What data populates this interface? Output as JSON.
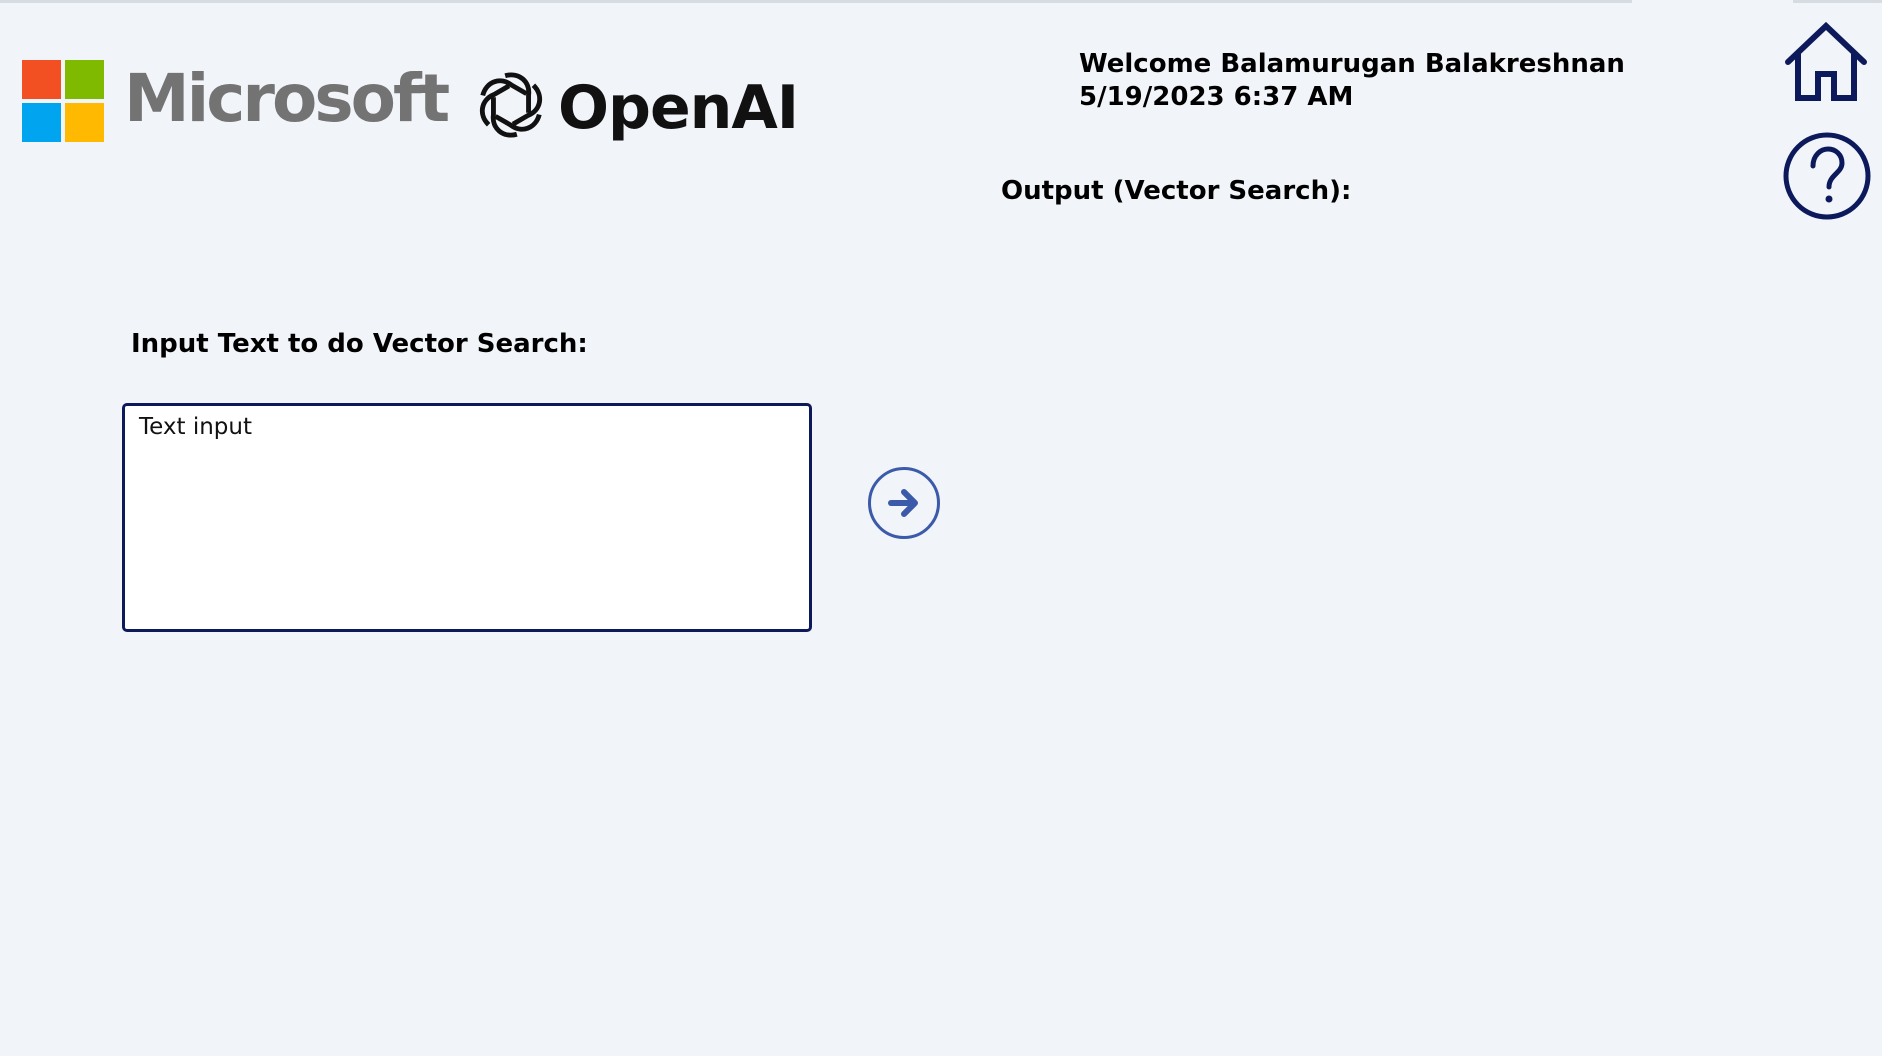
{
  "header": {
    "brand_microsoft": "Microsoft",
    "brand_openai": "OpenAI",
    "welcome_text": "Welcome Balamurugan Balakreshnan",
    "datetime": "5/19/2023 6:37 AM"
  },
  "main": {
    "output_label": "Output (Vector Search):",
    "input_label": "Input Text to do Vector Search:",
    "input_placeholder": "Text input",
    "input_value": ""
  },
  "icons": {
    "submit": "arrow-right-icon",
    "home": "home-icon",
    "help": "help-icon"
  },
  "colors": {
    "background": "#f1f4f9",
    "navy": "#0c1a5c",
    "accent_blue": "#3b5aa9",
    "ms_red": "#f25022",
    "ms_green": "#7fba00",
    "ms_blue": "#00a4ef",
    "ms_yellow": "#ffb900"
  }
}
